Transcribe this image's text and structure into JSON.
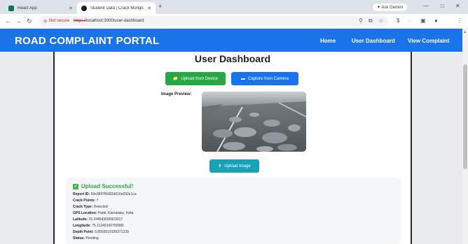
{
  "browser": {
    "tabs": [
      {
        "title": "React App",
        "active": false
      },
      {
        "title": "Student Data | Crack Mongo...",
        "active": true
      }
    ],
    "new_tab_symbol": "+",
    "ask_gemini": "✦ Ask Gemini",
    "window_controls": {
      "minimize": "—",
      "maximize": "□",
      "close": "✕"
    },
    "address": {
      "not_secure": "Not secure",
      "scheme": "https://",
      "rest": "localhost:3000/user-dashboard"
    }
  },
  "app": {
    "brand": "ROAD COMPLAINT PORTAL",
    "nav": [
      "Home",
      "User Dashboard",
      "View Complaint"
    ],
    "accent": "#1a73e8"
  },
  "dashboard": {
    "title": "User Dashboard",
    "upload_device": "Upload from Device",
    "capture_camera": "Capture from Camera",
    "preview_label": "Image Preview:",
    "upload_image": "Upload Image"
  },
  "result": {
    "heading": "Upload Successful!",
    "fields": [
      {
        "label": "Report ID:",
        "value": "69e3847f5682d916e692e1ca"
      },
      {
        "label": "Crack Points:",
        "value": "7"
      },
      {
        "label": "Crack Type:",
        "value": "Detected"
      },
      {
        "label": "GPS Location:",
        "value": "Hubli, Karnataka, India"
      },
      {
        "label": "Latitude:",
        "value": "15.344543095923017"
      },
      {
        "label": "Longitude:",
        "value": "75.11249100760986"
      },
      {
        "label": "Depth Point:",
        "value": "0.8055519199371339"
      },
      {
        "label": "Status:",
        "value": "Pending"
      }
    ]
  }
}
